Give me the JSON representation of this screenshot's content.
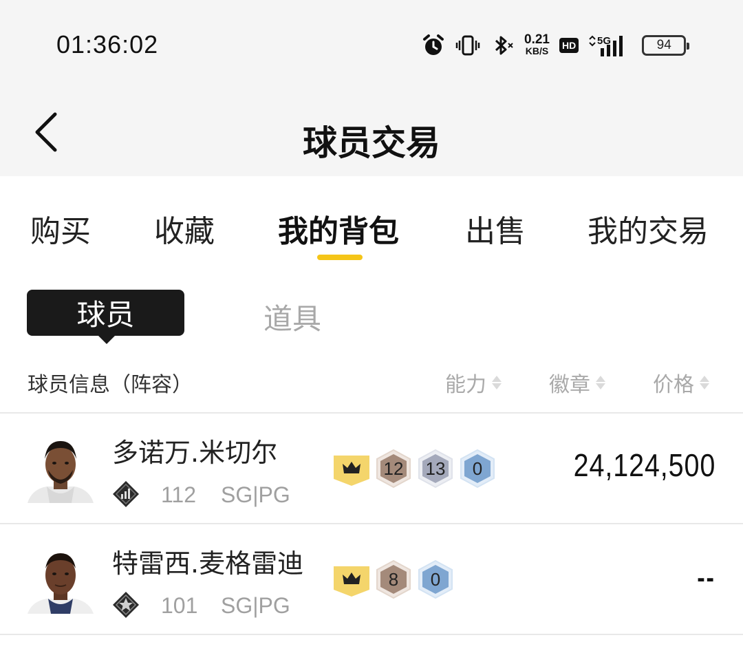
{
  "status_bar": {
    "time": "01:36:02",
    "net_speed_value": "0.21",
    "net_speed_unit": "KB/S",
    "hd_label": "HD",
    "network_label": "5G",
    "battery": "94",
    "icons": [
      "alarm-icon",
      "vibrate-icon",
      "bluetooth-icon",
      "signal-icon",
      "battery-icon"
    ]
  },
  "header": {
    "title": "球员交易",
    "back_icon": "chevron-left-icon"
  },
  "tabs": [
    {
      "label": "购买",
      "active": false
    },
    {
      "label": "收藏",
      "active": false
    },
    {
      "label": "我的背包",
      "active": true
    },
    {
      "label": "出售",
      "active": false
    },
    {
      "label": "我的交易",
      "active": false
    }
  ],
  "accent_color": "#f5c518",
  "segments": {
    "active": "球员",
    "inactive": "道具"
  },
  "columns": {
    "info": "球员信息（阵容）",
    "ability": "能力",
    "badge": "徽章",
    "price": "价格"
  },
  "players": [
    {
      "name": "多诺万.米切尔",
      "rating": "112",
      "positions": "SG|PG",
      "crown_badge": true,
      "badge_counts": [
        "12",
        "13",
        "0"
      ],
      "price": "24,124,500"
    },
    {
      "name": "特雷西.麦格雷迪",
      "rating": "101",
      "positions": "SG|PG",
      "crown_badge": true,
      "badge_counts": [
        "8",
        "0"
      ],
      "price": "--"
    }
  ]
}
